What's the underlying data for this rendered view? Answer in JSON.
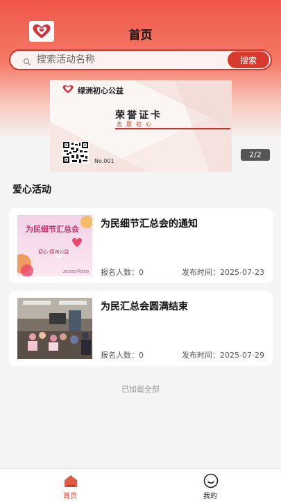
{
  "header": {
    "title": "首页"
  },
  "search": {
    "placeholder": "搜索活动名称",
    "button_label": "搜索"
  },
  "banner": {
    "org_name": "绿洲初心公益",
    "card_title": "荣誉证卡",
    "card_subtitle": "志愿初心",
    "card_number": "No.001",
    "counter": "2/2"
  },
  "section": {
    "title": "爱心活动"
  },
  "activities": [
    {
      "title": "为民细节汇总会的通知",
      "signup_label": "报名人数：0",
      "date_label": "发布时间：2025-07-23",
      "thumb_title": "为民细节汇总会",
      "thumb_subtitle": "初心·绿洲公益",
      "thumb_date": "2025年7月25日"
    },
    {
      "title": "为民汇总会圆满结束",
      "signup_label": "报名人数：0",
      "date_label": "发布时间：2025-07-29"
    }
  ],
  "footer": {
    "loaded_all": "已加载全部"
  },
  "tabbar": {
    "tabs": [
      {
        "label": "首页",
        "active": true
      },
      {
        "label": "我的",
        "active": false
      }
    ]
  },
  "colors": {
    "accent": "#d93a2e",
    "active_tab": "#d93a2e"
  }
}
